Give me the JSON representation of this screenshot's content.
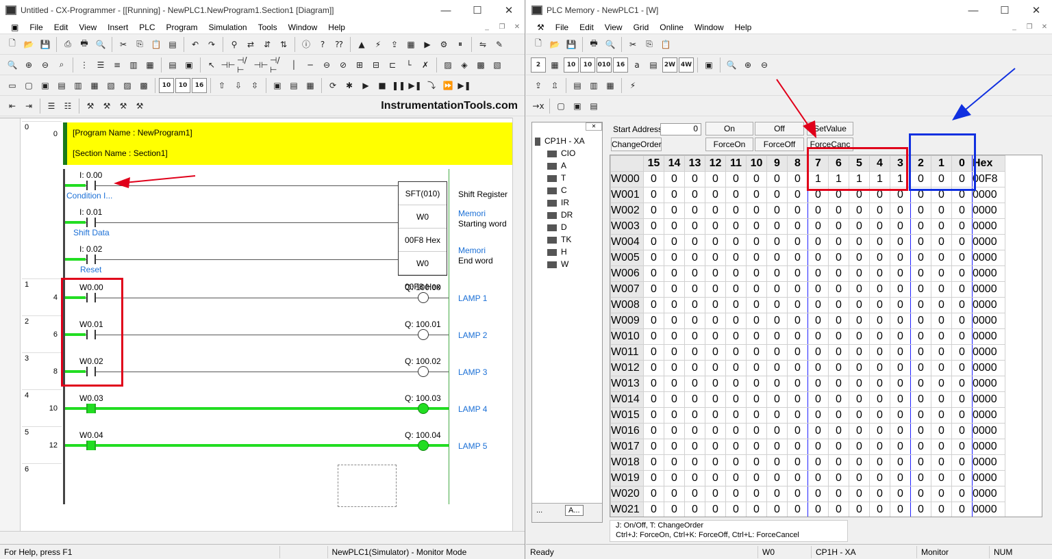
{
  "left": {
    "title": "Untitled - CX-Programmer - [[Running] - NewPLC1.NewProgram1.Section1 [Diagram]]",
    "menu": [
      "File",
      "Edit",
      "View",
      "Insert",
      "PLC",
      "Program",
      "Simulation",
      "Tools",
      "Window",
      "Help"
    ],
    "brand": "InstrumentationTools.com",
    "comment_program": "[Program Name : NewProgram1]",
    "comment_section": "[Section Name : Section1]",
    "rungs": [
      {
        "rung": "0",
        "step": "0"
      },
      {
        "rung": "1",
        "step": "4"
      },
      {
        "rung": "2",
        "step": "6"
      },
      {
        "rung": "3",
        "step": "8"
      },
      {
        "rung": "4",
        "step": "10"
      },
      {
        "rung": "5",
        "step": "12"
      },
      {
        "rung": "6",
        "step": ""
      }
    ],
    "inputs": [
      {
        "addr": "I: 0.00",
        "comment": "Condition I..."
      },
      {
        "addr": "I: 0.01",
        "comment": "Shift Data"
      },
      {
        "addr": "I: 0.02",
        "comment": "Reset"
      }
    ],
    "sft": {
      "name": "SFT(010)",
      "op1": "W0",
      "op1_val": "00F8 Hex",
      "op2": "W0",
      "op2_val": "00F8 Hex",
      "desc": "Shift Register",
      "c1a": "Memori",
      "c1b": "Starting word",
      "c2a": "Memori",
      "c2b": "End word"
    },
    "lamps": [
      {
        "contact": "W0.00",
        "coil": "Q: 100.00",
        "label": "LAMP 1",
        "on": false
      },
      {
        "contact": "W0.01",
        "coil": "Q: 100.01",
        "label": "LAMP 2",
        "on": false
      },
      {
        "contact": "W0.02",
        "coil": "Q: 100.02",
        "label": "LAMP 3",
        "on": false
      },
      {
        "contact": "W0.03",
        "coil": "Q: 100.03",
        "label": "LAMP 4",
        "on": true
      },
      {
        "contact": "W0.04",
        "coil": "Q: 100.04",
        "label": "LAMP 5",
        "on": true
      }
    ],
    "status": {
      "help": "For Help, press F1",
      "mode": "NewPLC1(Simulator) - Monitor Mode"
    }
  },
  "right": {
    "title": "PLC Memory - NewPLC1 - [W]",
    "menu": [
      "File",
      "Edit",
      "View",
      "Grid",
      "Online",
      "Window",
      "Help"
    ],
    "tree_root": "CP1H - XA",
    "tree_items": [
      "CIO",
      "A",
      "T",
      "C",
      "IR",
      "DR",
      "D",
      "TK",
      "H",
      "W"
    ],
    "start_address_label": "Start Address:",
    "start_address": "0",
    "buttons": {
      "on": "On",
      "off": "Off",
      "setvalue": "SetValue",
      "changeorder": "ChangeOrder",
      "forceon": "ForceOn",
      "forceoff": "ForceOff",
      "forcecanc": "ForceCanc"
    },
    "headers": [
      "15",
      "14",
      "13",
      "12",
      "11",
      "10",
      "9",
      "8",
      "7",
      "6",
      "5",
      "4",
      "3",
      "2",
      "1",
      "0",
      "Hex"
    ],
    "rows": [
      {
        "addr": "W000",
        "bits": [
          "0",
          "0",
          "0",
          "0",
          "0",
          "0",
          "0",
          "0",
          "1",
          "1",
          "1",
          "1",
          "1",
          "0",
          "0",
          "0"
        ],
        "hex": "00F8"
      },
      {
        "addr": "W001",
        "bits": [
          "0",
          "0",
          "0",
          "0",
          "0",
          "0",
          "0",
          "0",
          "0",
          "0",
          "0",
          "0",
          "0",
          "0",
          "0",
          "0"
        ],
        "hex": "0000"
      },
      {
        "addr": "W002",
        "bits": [
          "0",
          "0",
          "0",
          "0",
          "0",
          "0",
          "0",
          "0",
          "0",
          "0",
          "0",
          "0",
          "0",
          "0",
          "0",
          "0"
        ],
        "hex": "0000"
      },
      {
        "addr": "W003",
        "bits": [
          "0",
          "0",
          "0",
          "0",
          "0",
          "0",
          "0",
          "0",
          "0",
          "0",
          "0",
          "0",
          "0",
          "0",
          "0",
          "0"
        ],
        "hex": "0000"
      },
      {
        "addr": "W004",
        "bits": [
          "0",
          "0",
          "0",
          "0",
          "0",
          "0",
          "0",
          "0",
          "0",
          "0",
          "0",
          "0",
          "0",
          "0",
          "0",
          "0"
        ],
        "hex": "0000"
      },
      {
        "addr": "W005",
        "bits": [
          "0",
          "0",
          "0",
          "0",
          "0",
          "0",
          "0",
          "0",
          "0",
          "0",
          "0",
          "0",
          "0",
          "0",
          "0",
          "0"
        ],
        "hex": "0000"
      },
      {
        "addr": "W006",
        "bits": [
          "0",
          "0",
          "0",
          "0",
          "0",
          "0",
          "0",
          "0",
          "0",
          "0",
          "0",
          "0",
          "0",
          "0",
          "0",
          "0"
        ],
        "hex": "0000"
      },
      {
        "addr": "W007",
        "bits": [
          "0",
          "0",
          "0",
          "0",
          "0",
          "0",
          "0",
          "0",
          "0",
          "0",
          "0",
          "0",
          "0",
          "0",
          "0",
          "0"
        ],
        "hex": "0000"
      },
      {
        "addr": "W008",
        "bits": [
          "0",
          "0",
          "0",
          "0",
          "0",
          "0",
          "0",
          "0",
          "0",
          "0",
          "0",
          "0",
          "0",
          "0",
          "0",
          "0"
        ],
        "hex": "0000"
      },
      {
        "addr": "W009",
        "bits": [
          "0",
          "0",
          "0",
          "0",
          "0",
          "0",
          "0",
          "0",
          "0",
          "0",
          "0",
          "0",
          "0",
          "0",
          "0",
          "0"
        ],
        "hex": "0000"
      },
      {
        "addr": "W010",
        "bits": [
          "0",
          "0",
          "0",
          "0",
          "0",
          "0",
          "0",
          "0",
          "0",
          "0",
          "0",
          "0",
          "0",
          "0",
          "0",
          "0"
        ],
        "hex": "0000"
      },
      {
        "addr": "W011",
        "bits": [
          "0",
          "0",
          "0",
          "0",
          "0",
          "0",
          "0",
          "0",
          "0",
          "0",
          "0",
          "0",
          "0",
          "0",
          "0",
          "0"
        ],
        "hex": "0000"
      },
      {
        "addr": "W012",
        "bits": [
          "0",
          "0",
          "0",
          "0",
          "0",
          "0",
          "0",
          "0",
          "0",
          "0",
          "0",
          "0",
          "0",
          "0",
          "0",
          "0"
        ],
        "hex": "0000"
      },
      {
        "addr": "W013",
        "bits": [
          "0",
          "0",
          "0",
          "0",
          "0",
          "0",
          "0",
          "0",
          "0",
          "0",
          "0",
          "0",
          "0",
          "0",
          "0",
          "0"
        ],
        "hex": "0000"
      },
      {
        "addr": "W014",
        "bits": [
          "0",
          "0",
          "0",
          "0",
          "0",
          "0",
          "0",
          "0",
          "0",
          "0",
          "0",
          "0",
          "0",
          "0",
          "0",
          "0"
        ],
        "hex": "0000"
      },
      {
        "addr": "W015",
        "bits": [
          "0",
          "0",
          "0",
          "0",
          "0",
          "0",
          "0",
          "0",
          "0",
          "0",
          "0",
          "0",
          "0",
          "0",
          "0",
          "0"
        ],
        "hex": "0000"
      },
      {
        "addr": "W016",
        "bits": [
          "0",
          "0",
          "0",
          "0",
          "0",
          "0",
          "0",
          "0",
          "0",
          "0",
          "0",
          "0",
          "0",
          "0",
          "0",
          "0"
        ],
        "hex": "0000"
      },
      {
        "addr": "W017",
        "bits": [
          "0",
          "0",
          "0",
          "0",
          "0",
          "0",
          "0",
          "0",
          "0",
          "0",
          "0",
          "0",
          "0",
          "0",
          "0",
          "0"
        ],
        "hex": "0000"
      },
      {
        "addr": "W018",
        "bits": [
          "0",
          "0",
          "0",
          "0",
          "0",
          "0",
          "0",
          "0",
          "0",
          "0",
          "0",
          "0",
          "0",
          "0",
          "0",
          "0"
        ],
        "hex": "0000"
      },
      {
        "addr": "W019",
        "bits": [
          "0",
          "0",
          "0",
          "0",
          "0",
          "0",
          "0",
          "0",
          "0",
          "0",
          "0",
          "0",
          "0",
          "0",
          "0",
          "0"
        ],
        "hex": "0000"
      },
      {
        "addr": "W020",
        "bits": [
          "0",
          "0",
          "0",
          "0",
          "0",
          "0",
          "0",
          "0",
          "0",
          "0",
          "0",
          "0",
          "0",
          "0",
          "0",
          "0"
        ],
        "hex": "0000"
      },
      {
        "addr": "W021",
        "bits": [
          "0",
          "0",
          "0",
          "0",
          "0",
          "0",
          "0",
          "0",
          "0",
          "0",
          "0",
          "0",
          "0",
          "0",
          "0",
          "0"
        ],
        "hex": "0000"
      }
    ],
    "help1": "J:  On/Off,    T:  ChangeOrder",
    "help2": "Ctrl+J:  ForceOn,    Ctrl+K:  ForceOff,    Ctrl+L:  ForceCancel",
    "tabs": [
      "...",
      "A..."
    ],
    "status": {
      "ready": "Ready",
      "area": "W0",
      "plc": "CP1H - XA",
      "mode": "Monitor",
      "num": "NUM"
    }
  },
  "colors": {
    "on_green": "#22dd22",
    "highlight_red": "#e0001a",
    "highlight_blue": "#1030e0",
    "comment_yellow": "#ffff00"
  }
}
